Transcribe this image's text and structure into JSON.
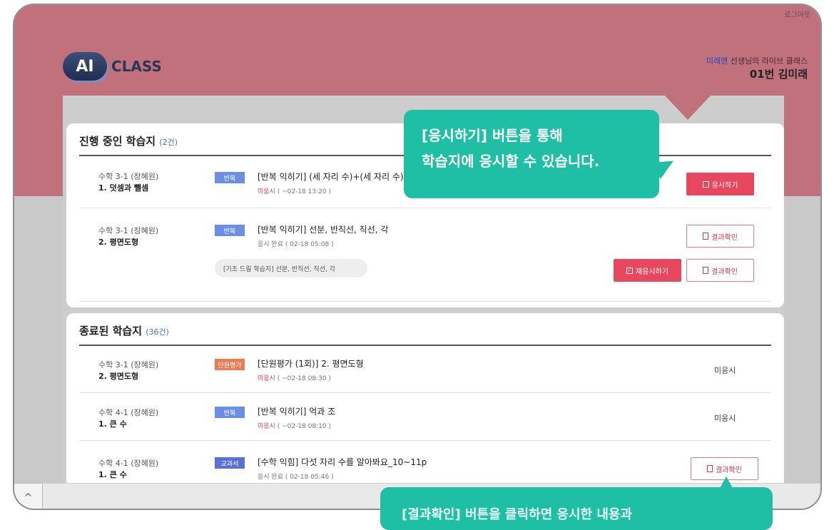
{
  "header": {
    "logout": "로그아웃",
    "logo_badge": "AI",
    "logo_text": "CLASS",
    "teacher_name": "미래엔",
    "teacher_suffix": " 선생님의 라이브 클래스",
    "student": "01번 김미래"
  },
  "colors": {
    "brand_band": "#c0717c",
    "accent_red": "#e8485f",
    "tooltip_teal": "#1fbfa6",
    "count_blue": "#4a6bd2"
  },
  "in_progress": {
    "title": "진행 중인 학습지",
    "count": "(2건)",
    "rows": [
      {
        "subject": "수학 3-1 (장혜원)",
        "unit": "1. 덧셈과 뺄셈",
        "tag": "반복",
        "title": "[반복 익히기] (세 자리 수)+(세 자리 수)(1)",
        "status_label": "미응시",
        "status_date": "( ~02-18 13:20 )",
        "action": "응시하기",
        "action_icon": "square-icon"
      },
      {
        "subject": "수학 3-1 (장혜원)",
        "unit": "2. 평면도형",
        "tag": "반복",
        "title": "[반복 익히기] 선분, 반직선, 직선, 각",
        "status_label": "응시 완료",
        "status_date": "( 02-18 05:08 )",
        "action": "결과확인",
        "action_icon": "document-icon",
        "sub_item": "[기초 드릴 학습지] 선분, 반직선, 직선, 각",
        "sub_retry": "재응시하기",
        "sub_retry_icon": "check-square-icon",
        "sub_action": "결과확인"
      }
    ]
  },
  "finished": {
    "title": "종료된 학습지",
    "count": "(36건)",
    "rows": [
      {
        "subject": "수학 3-1 (장혜원)",
        "unit": "2. 평면도형",
        "tag": "단원평가",
        "title": "[단원평가 (1회)] 2. 평면도형",
        "status_label": "미응시",
        "status_date": "( ~02-18 08:30 )",
        "result": "미응시"
      },
      {
        "subject": "수학 4-1 (장혜원)",
        "unit": "1. 큰 수",
        "tag": "반복",
        "title": "[반복 익히기] 억과 조",
        "status_label": "미응시",
        "status_date": "( ~02-18 08:10 )",
        "result": "미응시"
      },
      {
        "subject": "수학 4-1 (장혜원)",
        "unit": "1. 큰 수",
        "tag": "교과서",
        "title": "[수학 익힘] 다섯 자리 수를 알아봐요_10~11p",
        "status_label": "응시 완료",
        "status_date": "( 02-18 05:46 )",
        "result": "결과확인"
      }
    ]
  },
  "tooltip1": {
    "line1": "[응시하기] 버튼을 통해",
    "line2": "학습지에 응시할 수 있습니다."
  },
  "tooltip2": {
    "text": "[결과확인] 버튼을 클릭하면 응시한 내용과"
  },
  "scroll_up": "^"
}
